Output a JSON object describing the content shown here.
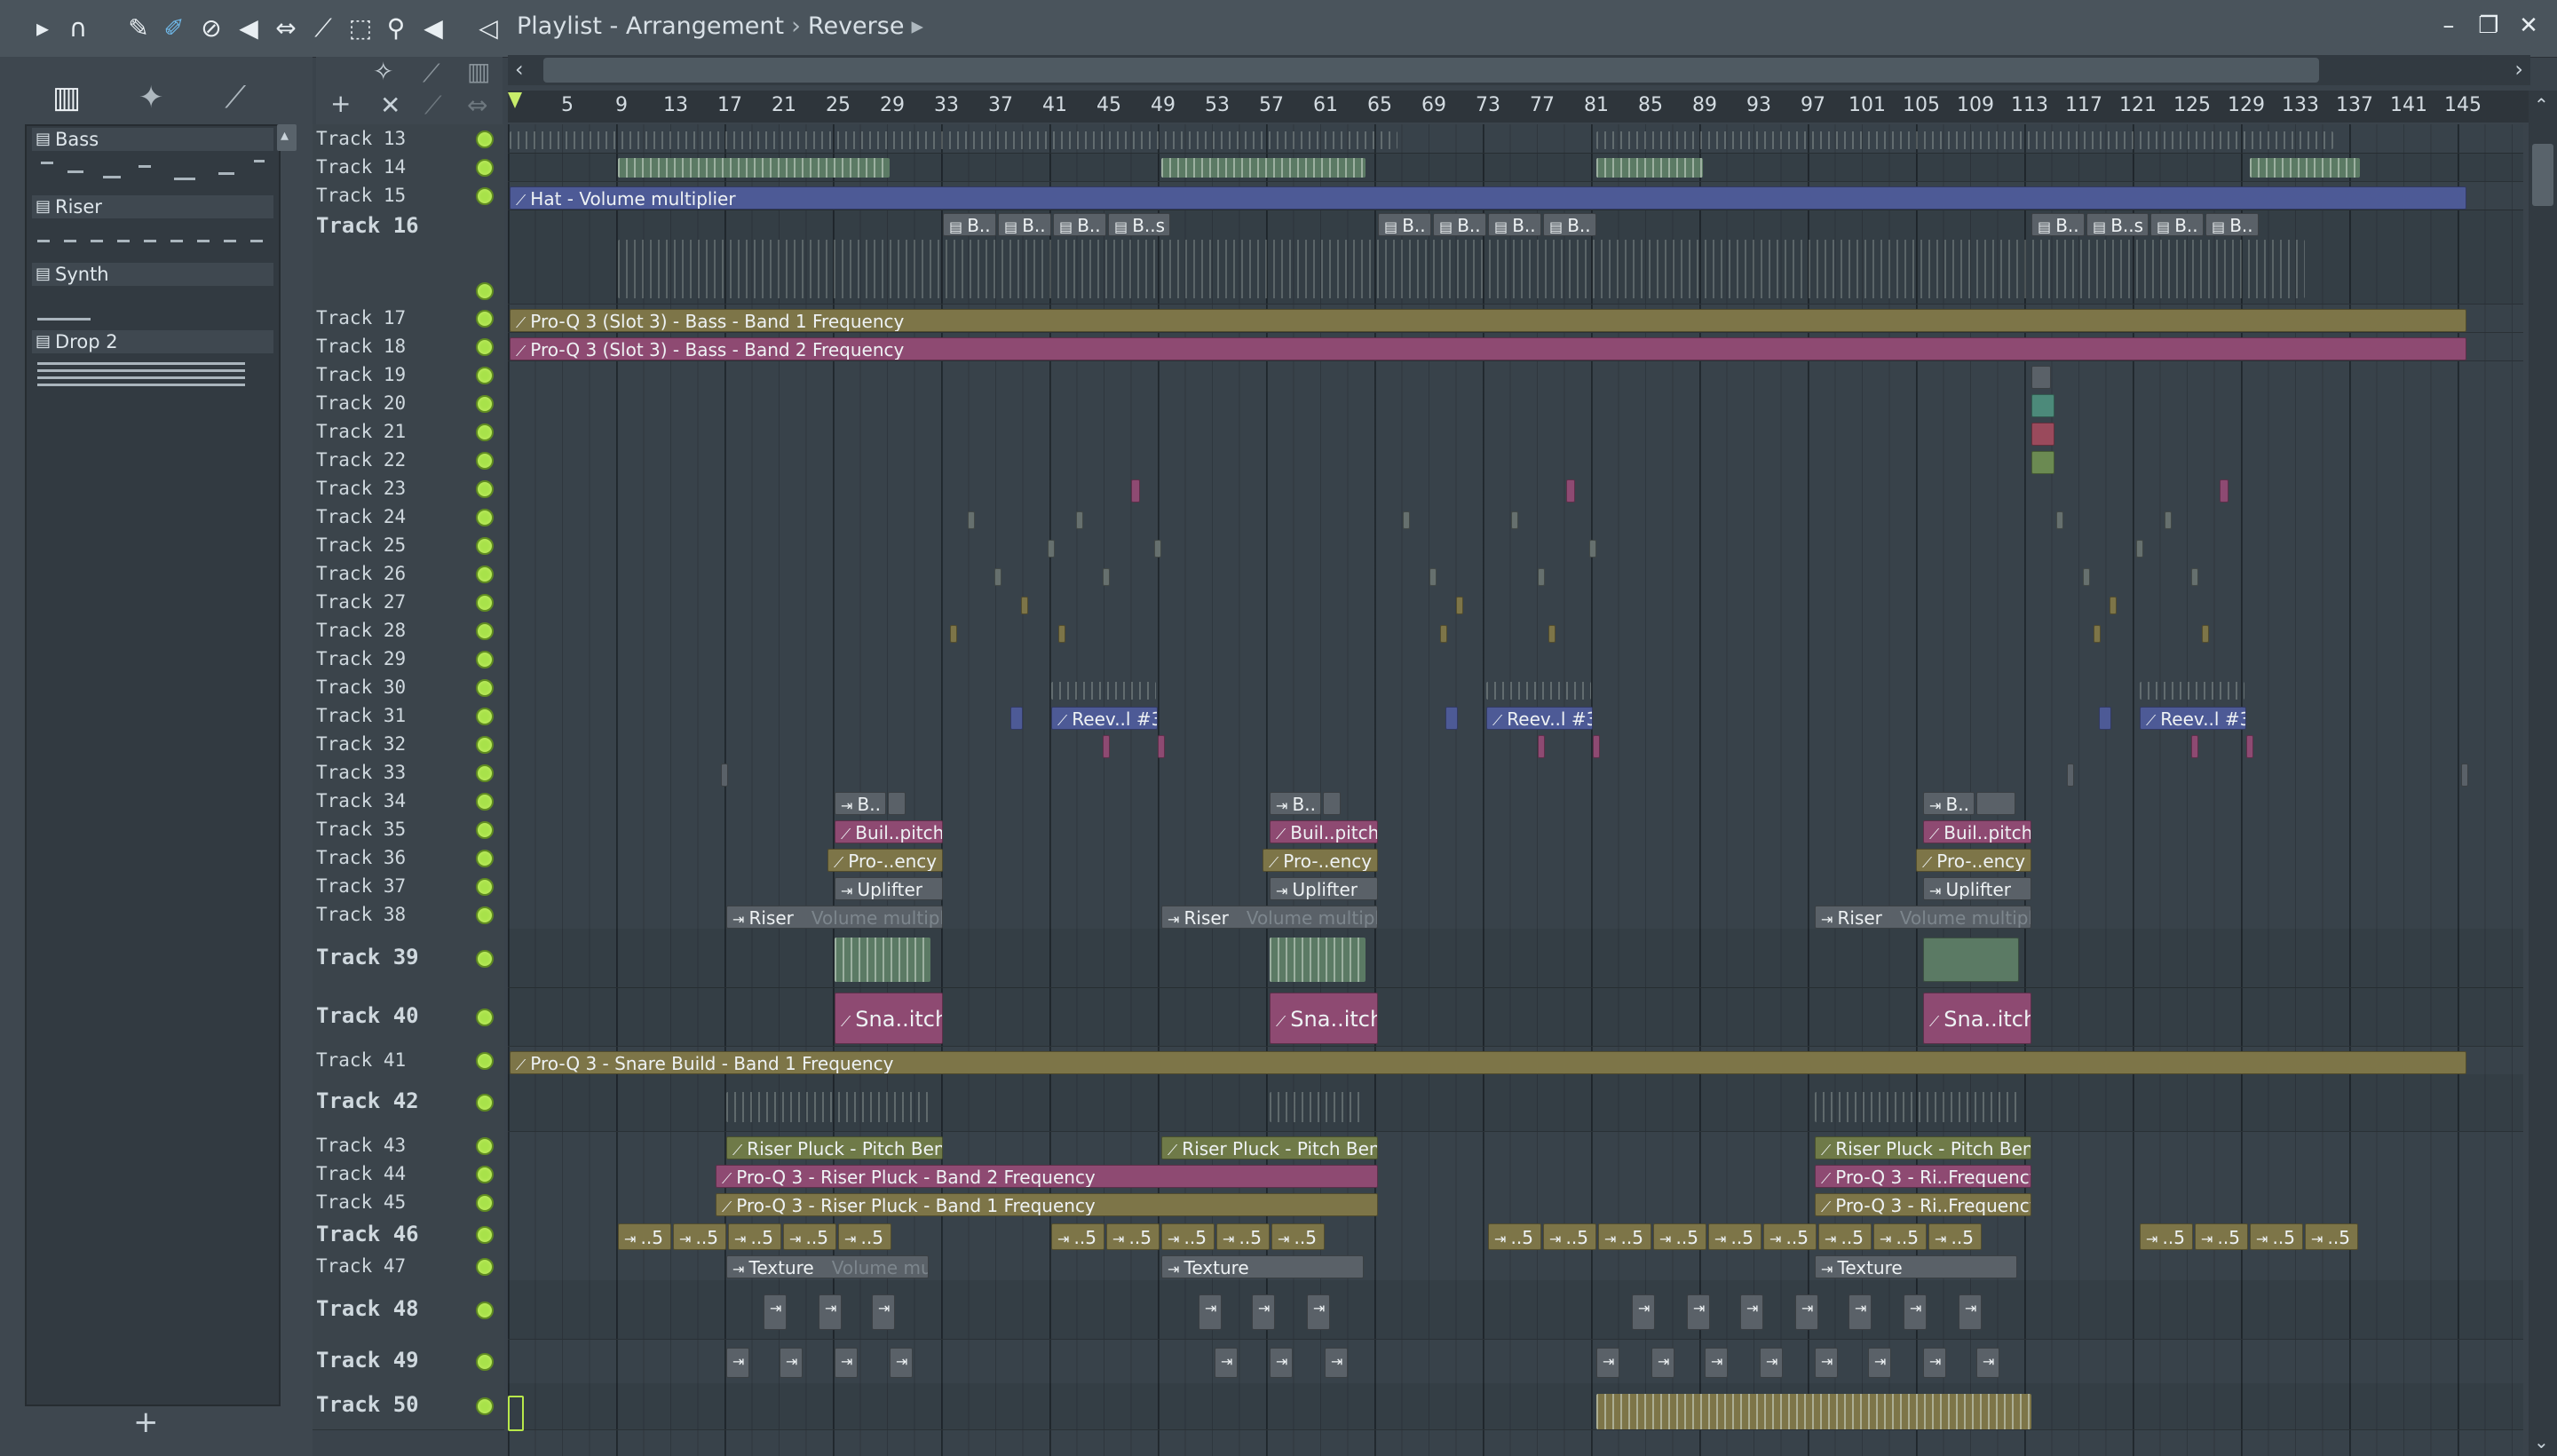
{
  "window": {
    "title": "Playlist - Arrangement",
    "breadcrumb_separator": "›",
    "pattern_name": "Reverse",
    "controls": {
      "minimize": "–",
      "restore": "❐",
      "close": "✕"
    }
  },
  "toolbar": {
    "icons": [
      "play-arrow-icon",
      "magnet-icon",
      "pencil-icon",
      "paint-icon",
      "delete-icon",
      "mute-icon",
      "slip-icon",
      "slice-icon",
      "select-icon",
      "zoom-icon",
      "playback-icon",
      "speaker-icon"
    ]
  },
  "picker": {
    "add_label": "+",
    "items": [
      {
        "name": "Bass"
      },
      {
        "name": "Riser"
      },
      {
        "name": "Synth"
      },
      {
        "name": "Drop 2"
      }
    ]
  },
  "ruler": {
    "bars": [
      "5",
      "9",
      "13",
      "17",
      "21",
      "25",
      "29",
      "33",
      "37",
      "41",
      "45",
      "49",
      "53",
      "57",
      "61",
      "65",
      "69",
      "73",
      "77",
      "81",
      "85",
      "89",
      "93",
      "97",
      "101",
      "105",
      "109",
      "113",
      "117",
      "121",
      "125",
      "129",
      "133",
      "137",
      "141",
      "145"
    ]
  },
  "tracks": [
    {
      "name": "Track 13"
    },
    {
      "name": "Track 14"
    },
    {
      "name": "Track 15"
    },
    {
      "name": "Track 16"
    },
    {
      "name": "Track 17"
    },
    {
      "name": "Track 18"
    },
    {
      "name": "Track 19"
    },
    {
      "name": "Track 20"
    },
    {
      "name": "Track 21"
    },
    {
      "name": "Track 22"
    },
    {
      "name": "Track 23"
    },
    {
      "name": "Track 24"
    },
    {
      "name": "Track 25"
    },
    {
      "name": "Track 26"
    },
    {
      "name": "Track 27"
    },
    {
      "name": "Track 28"
    },
    {
      "name": "Track 29"
    },
    {
      "name": "Track 30"
    },
    {
      "name": "Track 31"
    },
    {
      "name": "Track 32"
    },
    {
      "name": "Track 33"
    },
    {
      "name": "Track 34"
    },
    {
      "name": "Track 35"
    },
    {
      "name": "Track 36"
    },
    {
      "name": "Track 37"
    },
    {
      "name": "Track 38"
    },
    {
      "name": "Track 39"
    },
    {
      "name": "Track 40"
    },
    {
      "name": "Track 41"
    },
    {
      "name": "Track 42"
    },
    {
      "name": "Track 43"
    },
    {
      "name": "Track 44"
    },
    {
      "name": "Track 45"
    },
    {
      "name": "Track 46"
    },
    {
      "name": "Track 47"
    },
    {
      "name": "Track 48"
    },
    {
      "name": "Track 49"
    },
    {
      "name": "Track 50"
    }
  ],
  "clips": {
    "hat_volume": "Hat - Volume multiplier",
    "proq_bass_band1": "Pro-Q 3 (Slot 3) - Bass - Band 1 Frequency",
    "proq_bass_band2": "Pro-Q 3 (Slot 3) - Bass - Band 2 Frequency",
    "track16_b1": "B..",
    "track16_bs": "B..s",
    "reev": "Reev..l #3",
    "track34": "B..",
    "build_pitch": "Buil..pitch",
    "proq_ency": "Pro-..ency",
    "uplifter": "Uplifter",
    "riser": "Riser",
    "riser_ghost": "Volume multiplier",
    "snare_pitch": "Sna..itch",
    "proq_snare": "Pro-Q 3 - Snare Build - Band 1 Frequency",
    "riser_pluck_pitch": "Riser Pluck - Pitch Bend",
    "proq_riser_band2": "Pro-Q 3 - Riser Pluck - Band 2 Frequency",
    "proq_riser_band1": "Pro-Q 3 - Riser Pluck - Band 1 Frequency",
    "proq_ri_freq": "Pro-Q 3 - Ri..Frequency",
    "t46": "..5",
    "texture": "Texture",
    "texture_ghost": "Volume multiplier"
  }
}
